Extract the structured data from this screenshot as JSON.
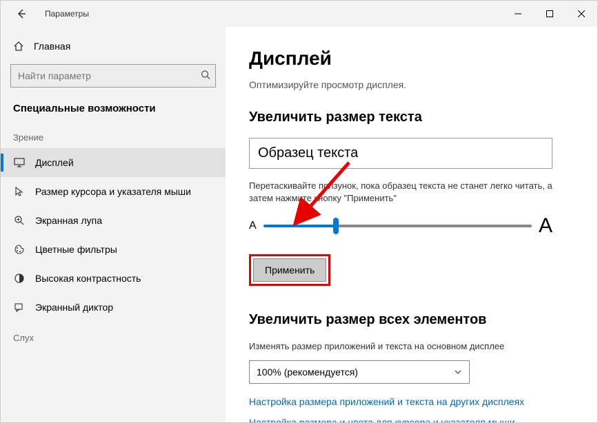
{
  "window": {
    "title": "Параметры"
  },
  "sidebar": {
    "home": "Главная",
    "search_placeholder": "Найти параметр",
    "section": "Специальные возможности",
    "group_vision": "Зрение",
    "group_hearing": "Слух",
    "items": [
      {
        "label": "Дисплей"
      },
      {
        "label": "Размер курсора и указателя мыши"
      },
      {
        "label": "Экранная лупа"
      },
      {
        "label": "Цветные фильтры"
      },
      {
        "label": "Высокая контрастность"
      },
      {
        "label": "Экранный диктор"
      }
    ]
  },
  "main": {
    "heading": "Дисплей",
    "subtitle": "Оптимизируйте просмотр дисплея.",
    "section1_heading": "Увеличить размер текста",
    "sample_text": "Образец текста",
    "slider_desc": "Перетаскивайте ползунок, пока образец текста не станет легко читать, а затем нажмите кнопку \"Применить\"",
    "small_a": "A",
    "big_a": "A",
    "apply_label": "Применить",
    "section2_heading": "Увеличить размер всех элементов",
    "dropdown_desc": "Изменять размер приложений и текста на основном дисплее",
    "dropdown_value": "100% (рекомендуется)",
    "link1": "Настройка размера приложений и текста на других дисплеях",
    "link2": "Настройка размера и цвета для курсора и указателя мыши"
  },
  "annotation": {
    "arrow_color": "#e60000"
  }
}
